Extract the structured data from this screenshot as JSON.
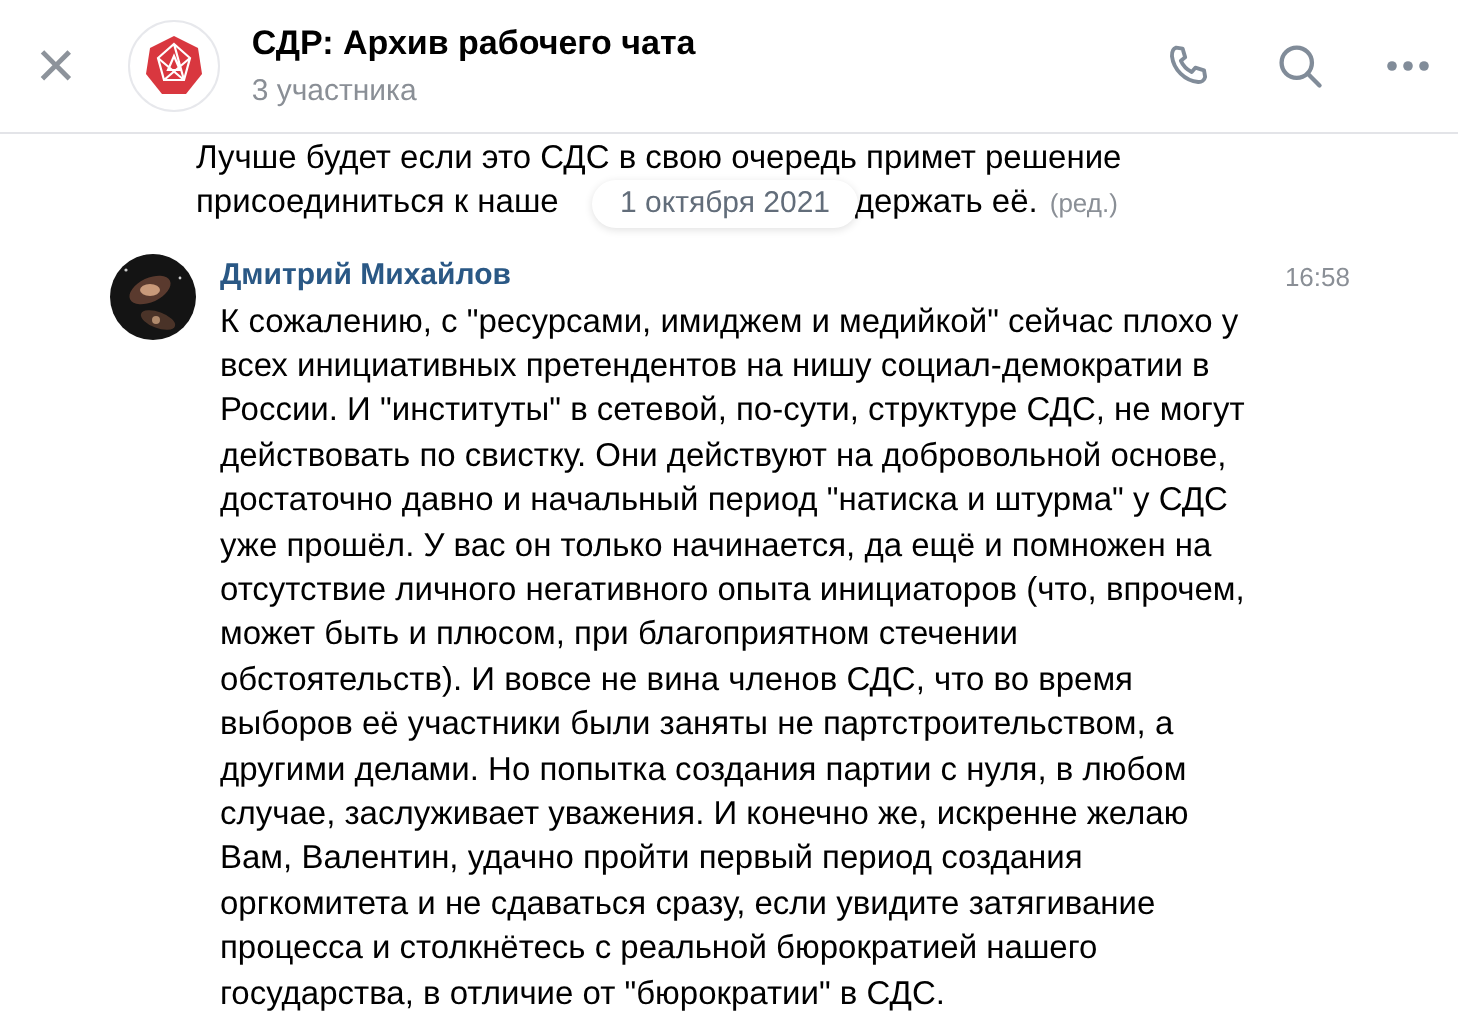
{
  "header": {
    "close_glyph": "×",
    "title": "СДР: Архив рабочего чата",
    "subtitle": "3 участника"
  },
  "previous_message": {
    "line_1": "Лучше будет если это СДС в свою очередь примет решение",
    "line_2_start": "присоединиться к наше",
    "line_2_end": "держать её.",
    "edited": "(ред.)"
  },
  "date_divider": "1 октября 2021",
  "message": {
    "author": "Дмитрий Михайлов",
    "time": "16:58",
    "lines": [
      "К сожалению, с \"ресурсами, имиджем и медийкой\" сейчас плохо у",
      "всех инициативных претендентов на нишу социал-демократии в",
      "России. И \"институты\" в сетевой, по-сути, структуре СДС, не могут",
      "действовать по свистку. Они действуют на добровольной основе,",
      "достаточно давно и начальный период  \"натиска и штурма\" у СДС",
      "уже прошёл. У вас он только начинается, да ещё и помножен на",
      "отсутствие личного негативного опыта инициаторов (что, впрочем,",
      "может быть и плюсом, при благоприятном стечении",
      "обстоятельств). И вовсе не вина членов СДС, что во время",
      "выборов её участники были заняты не партстроительством, а",
      "другими делами.  Но попытка создания партии с нуля, в любом",
      "случае, заслуживает уважения. И конечно же, искренне желаю",
      "Вам, Валентин, удачно пройти первый период создания",
      "оргкомитета и не сдаваться сразу, если увидите затягивание",
      "процесса и столкнётесь с реальной бюрократией нашего",
      "государства, в отличие от \"бюрократии\" в СДС."
    ]
  }
}
